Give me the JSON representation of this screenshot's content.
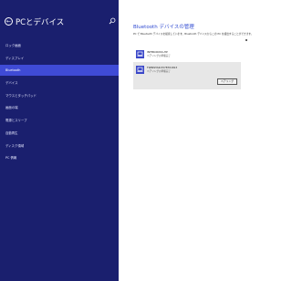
{
  "sidebar": {
    "title": "PCとデバイス",
    "items": [
      {
        "label": "ロック画面"
      },
      {
        "label": "ディスプレイ"
      },
      {
        "label": "Bluetooth"
      },
      {
        "label": "デバイス"
      },
      {
        "label": "マウスとタッチパッド"
      },
      {
        "label": "画面の端"
      },
      {
        "label": "電源とスリープ"
      },
      {
        "label": "自動再生"
      },
      {
        "label": "ディスク領域"
      },
      {
        "label": "PC 情報"
      }
    ],
    "selected_index": 2
  },
  "main": {
    "title": "Bluetooth デバイスの管理",
    "description": "PC で Bluetooth デバイスを検索しています。Bluetooth デバイスからこの PC を検出することができます。",
    "devices": [
      {
        "name": "INTERCROSS-HP",
        "status": "ペアリングの準備完了"
      },
      {
        "name": "TWINSTAR-5578701813",
        "status": "ペアリングの準備完了",
        "button_label": "ペアリング"
      }
    ]
  },
  "colors": {
    "sidebar_bg": "#1a1f6e",
    "selected_bg": "#3f4bd6",
    "accent": "#2f4ad1",
    "device_selected_bg": "#e7e7e7"
  }
}
